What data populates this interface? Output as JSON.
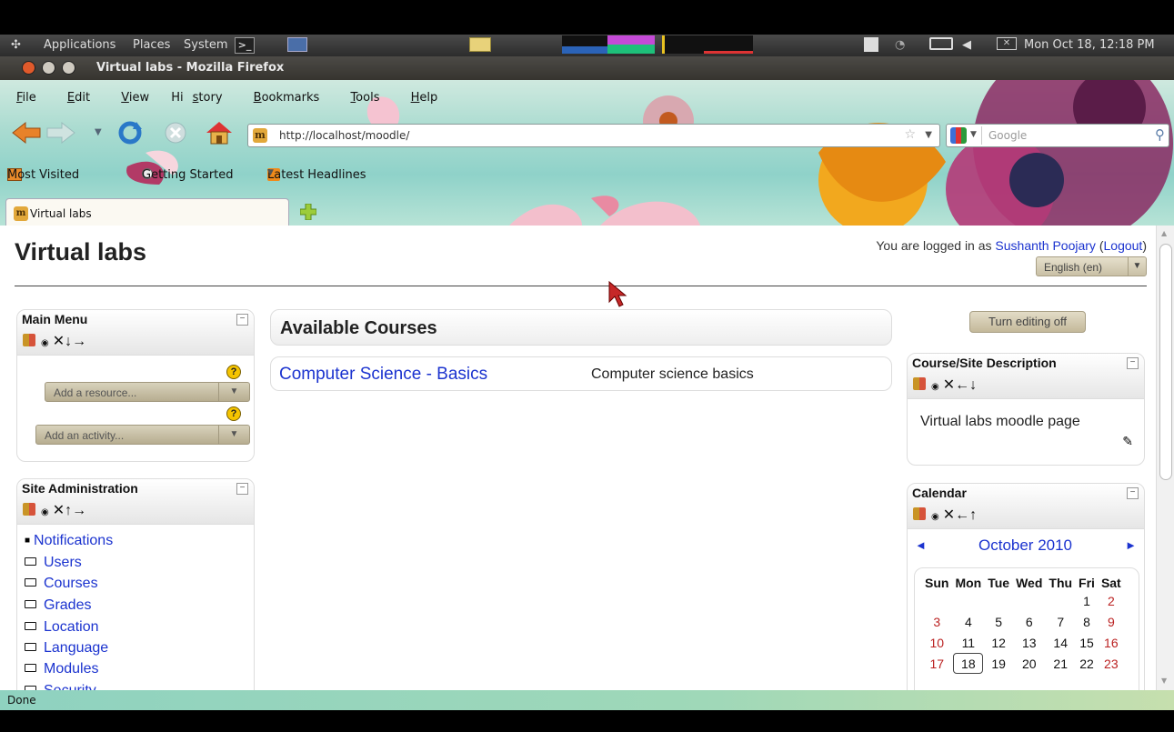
{
  "panel": {
    "applications": "Applications",
    "places": "Places",
    "system": "System",
    "clock": "Mon Oct 18, 12:18 PM"
  },
  "window": {
    "title": "Virtual labs - Mozilla Firefox"
  },
  "menubar": [
    {
      "pre": "",
      "u": "F",
      "post": "ile"
    },
    {
      "pre": "",
      "u": "E",
      "post": "dit"
    },
    {
      "pre": "",
      "u": "V",
      "post": "iew"
    },
    {
      "pre": "Hi",
      "u": "s",
      "post": "tory"
    },
    {
      "pre": "",
      "u": "B",
      "post": "ookmarks"
    },
    {
      "pre": "",
      "u": "T",
      "post": "ools"
    },
    {
      "pre": "",
      "u": "H",
      "post": "elp"
    }
  ],
  "url": "http://localhost/moodle/",
  "search_placeholder": "Google",
  "bookmarks": {
    "most_visited": "Most Visited",
    "getting_started": "Getting Started",
    "latest_headlines": "Latest Headlines"
  },
  "tab": {
    "label": "Virtual labs"
  },
  "page": {
    "site_title": "Virtual labs",
    "login_prefix": "You are logged in as ",
    "login_user": "Sushanth Poojary",
    "logout": "Logout",
    "language": "English (en)",
    "main_menu": {
      "title": "Main Menu",
      "add_resource": "Add a resource...",
      "add_activity": "Add an activity..."
    },
    "site_admin": {
      "title": "Site Administration",
      "items": [
        "Notifications",
        "Users",
        "Courses",
        "Grades",
        "Location",
        "Language",
        "Modules",
        "Security"
      ]
    },
    "courses": {
      "title": "Available Courses",
      "rows": [
        {
          "name": "Computer Science - Basics",
          "summary": "Computer science basics"
        }
      ]
    },
    "turn_editing": "Turn editing off",
    "site_desc": {
      "title": "Course/Site Description",
      "text": "Virtual labs moodle page"
    },
    "calendar": {
      "title": "Calendar",
      "month": "October 2010",
      "days": [
        "Sun",
        "Mon",
        "Tue",
        "Wed",
        "Thu",
        "Fri",
        "Sat"
      ],
      "weeks": [
        [
          "",
          "",
          "",
          "",
          "",
          "1",
          "2"
        ],
        [
          "3",
          "4",
          "5",
          "6",
          "7",
          "8",
          "9"
        ],
        [
          "10",
          "11",
          "12",
          "13",
          "14",
          "15",
          "16"
        ],
        [
          "17",
          "18",
          "19",
          "20",
          "21",
          "22",
          "23"
        ]
      ],
      "today": "18"
    }
  },
  "status": "Done",
  "colors": {
    "link": "#1b33cf",
    "weekend": "#b22222",
    "panel": "#3a3a3a"
  }
}
